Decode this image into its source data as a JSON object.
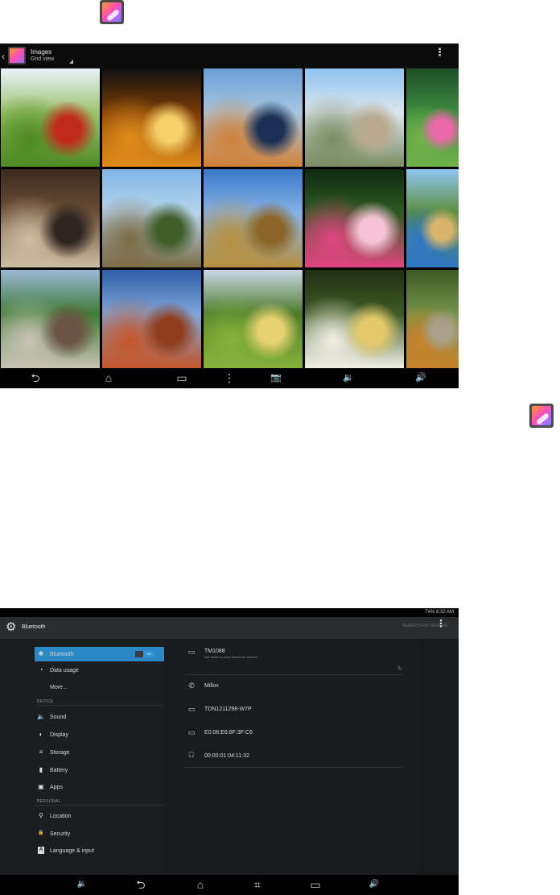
{
  "gallery": {
    "title": "Images",
    "subtitle": "Grid view",
    "menu_glyph": "⋮",
    "tiles": [
      {
        "name": "poppies",
        "colors": [
          "#e9f2fb",
          "#9dc36c",
          "#4e8a22",
          "#c02a1b"
        ]
      },
      {
        "name": "abstract-gold",
        "colors": [
          "#111",
          "#7a3b06",
          "#e08c1a",
          "#f6cf6a"
        ]
      },
      {
        "name": "seastack-rock",
        "colors": [
          "#6aa0d8",
          "#a8c6e0",
          "#d1823a",
          "#1a2f53"
        ]
      },
      {
        "name": "conservatory",
        "colors": [
          "#8ec3f0",
          "#dce6ee",
          "#7b8d63",
          "#b8a98f"
        ]
      },
      {
        "name": "water-lily",
        "colors": [
          "#1f4f2a",
          "#3c8a3d",
          "#70b24a",
          "#e86aa8"
        ]
      },
      {
        "name": "baseball-frame",
        "colors": [
          "#3d2a1e",
          "#6b4f37",
          "#cdbda1",
          "#2e2420"
        ]
      },
      {
        "name": "lighthouse",
        "colors": [
          "#7fb6e6",
          "#b8d4ec",
          "#7b6b45",
          "#3f5e2a"
        ]
      },
      {
        "name": "hay-bale",
        "colors": [
          "#3b78c9",
          "#86b2e5",
          "#b7903e",
          "#8a6526"
        ]
      },
      {
        "name": "pink-lilies",
        "colors": [
          "#0f2a12",
          "#2f5b21",
          "#e0457f",
          "#f6c2d6"
        ]
      },
      {
        "name": "dinosaur-statue",
        "colors": [
          "#8fc6f0",
          "#5b8d3a",
          "#2f76c9",
          "#d8b46a"
        ]
      },
      {
        "name": "stadium",
        "colors": [
          "#9bb7d6",
          "#3f7c35",
          "#c9c3b5",
          "#6c5444"
        ]
      },
      {
        "name": "delicate-arch",
        "colors": [
          "#2f5ea8",
          "#7fa6d8",
          "#c4562a",
          "#8e3c1c"
        ]
      },
      {
        "name": "garden-gazebo",
        "colors": [
          "#c9d9e8",
          "#4e7a2b",
          "#86b23c",
          "#e6d270"
        ]
      },
      {
        "name": "white-lily",
        "colors": [
          "#1f2f14",
          "#3e5b24",
          "#f2f0e6",
          "#e4c96a"
        ]
      },
      {
        "name": "tiger",
        "colors": [
          "#3b5a24",
          "#76934a",
          "#c9822b",
          "#a9a08a"
        ]
      }
    ],
    "nav": {
      "back": "⮌",
      "home": "⌂",
      "recents": "▭",
      "menu": "⋮",
      "camera": "📷",
      "vol_down": "🔉",
      "vol_up": "🔊"
    }
  },
  "settings": {
    "status_time": "8:32 AM",
    "status_battery": "74%",
    "title": "Bluetooth",
    "search_label": "SEARCH FOR DEVICES",
    "more_glyph": "⋮",
    "toggle_label": "ON",
    "items": [
      {
        "key": "bluetooth",
        "label": "Bluetooth",
        "icon": "✱",
        "selected": true
      },
      {
        "key": "data-usage",
        "label": "Data usage",
        "icon": "◔"
      },
      {
        "key": "more",
        "label": "More...",
        "icon": ""
      }
    ],
    "device_header": "DEVICE",
    "device_items": [
      {
        "key": "sound",
        "label": "Sound",
        "icon": "🔈"
      },
      {
        "key": "display",
        "label": "Display",
        "icon": "◐"
      },
      {
        "key": "storage",
        "label": "Storage",
        "icon": "≡"
      },
      {
        "key": "battery",
        "label": "Battery",
        "icon": "▮"
      },
      {
        "key": "apps",
        "label": "Apps",
        "icon": "▣"
      }
    ],
    "personal_header": "PERSONAL",
    "personal_items": [
      {
        "key": "location",
        "label": "Location",
        "icon": "⚲"
      },
      {
        "key": "security",
        "label": "Security",
        "icon": "🔒"
      },
      {
        "key": "language",
        "label": "Language & input",
        "icon": "A"
      }
    ],
    "own_device": {
      "name": "TM1088",
      "subtitle": "Not visible to other Bluetooth devices"
    },
    "paired_devices": [
      {
        "name": "Millox",
        "icon": "✆"
      },
      {
        "name": "TDN1211298-W7P",
        "icon": "▭"
      },
      {
        "name": "E0:06:E6:8F:3F:C6",
        "icon": "▭"
      },
      {
        "name": "00:00:01:04:11:32",
        "icon": "🎧"
      }
    ],
    "nav": {
      "vol_down": "🔉",
      "back": "⮌",
      "home": "⌂",
      "screenshot": "⌗",
      "recents": "▭",
      "vol_up": "🔊"
    }
  }
}
